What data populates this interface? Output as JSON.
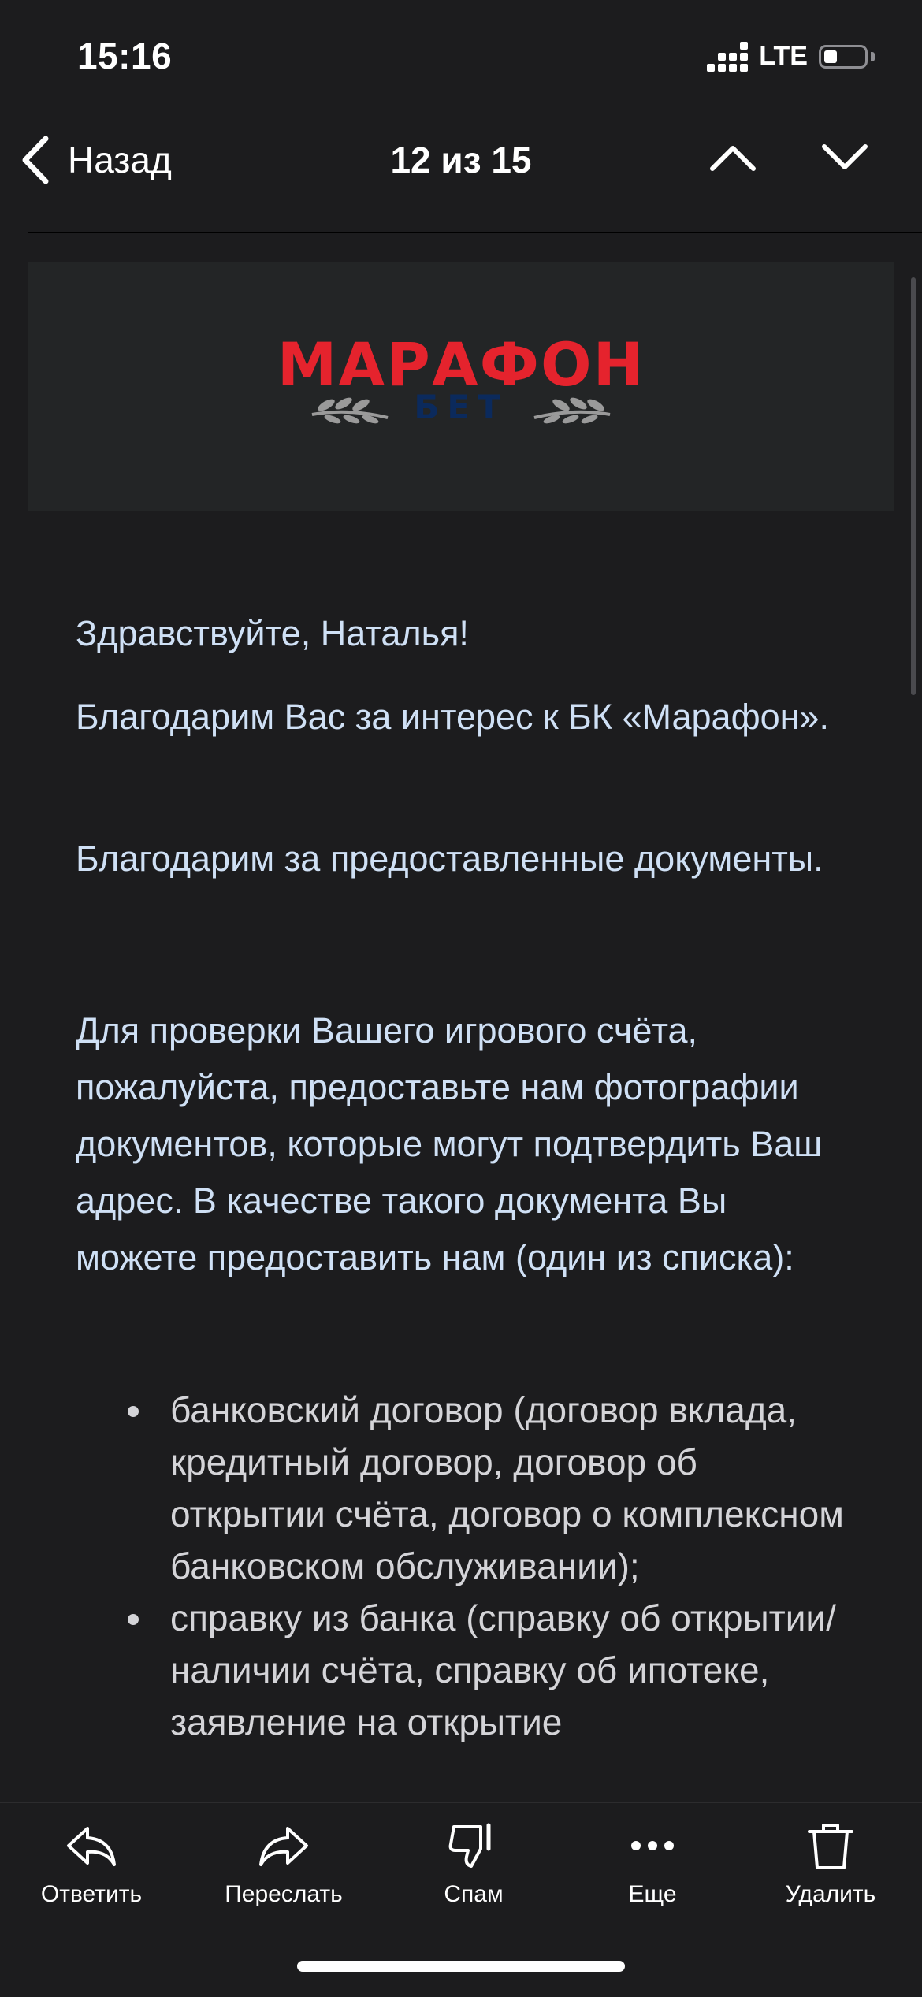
{
  "status_bar": {
    "time": "15:16",
    "network": "LTE",
    "signal_icon": "signal-bars-icon",
    "battery_icon": "battery-icon",
    "battery_level": 0.25
  },
  "nav": {
    "back_label": "Назад",
    "counter": "12 из 15",
    "up_icon": "chevron-up-icon",
    "down_icon": "chevron-down-icon"
  },
  "banner": {
    "logo_text": "МАРАФОН",
    "logo_sub": "БЕТ",
    "logo_color": "#e5232d",
    "logo_sub_color": "#0b2a5c"
  },
  "email": {
    "greeting": "Здравствуйте, Наталья!",
    "paragraphs": [
      "Благодарим Вас за интерес к БК «Марафон».",
      "Благодарим за предоставленные документы.",
      "Для проверки Вашего игрового счёта, пожалуйста, предоставьте нам фотографии документов, которые могут подтвердить Ваш адрес. В качестве такого документа Вы можете предоставить нам (один из списка):"
    ],
    "list": [
      "банковский договор (договор вклада, кредитный договор, договор об открытии счёта, договор о комплексном банковском обслуживании);",
      "справку из банка (справку об открытии/наличии счёта, справку об ипотеке, заявление на открытие"
    ]
  },
  "toolbar": {
    "reply": {
      "label": "Ответить",
      "icon": "reply-icon"
    },
    "forward": {
      "label": "Переслать",
      "icon": "forward-icon"
    },
    "spam": {
      "label": "Спам",
      "icon": "thumbs-down-icon"
    },
    "more": {
      "label": "Еще",
      "icon": "more-dots-icon"
    },
    "delete": {
      "label": "Удалить",
      "icon": "trash-icon"
    }
  },
  "colors": {
    "background": "#1c1c1e",
    "body_text": "#cfe0f5",
    "list_text": "#d4d4d8"
  }
}
